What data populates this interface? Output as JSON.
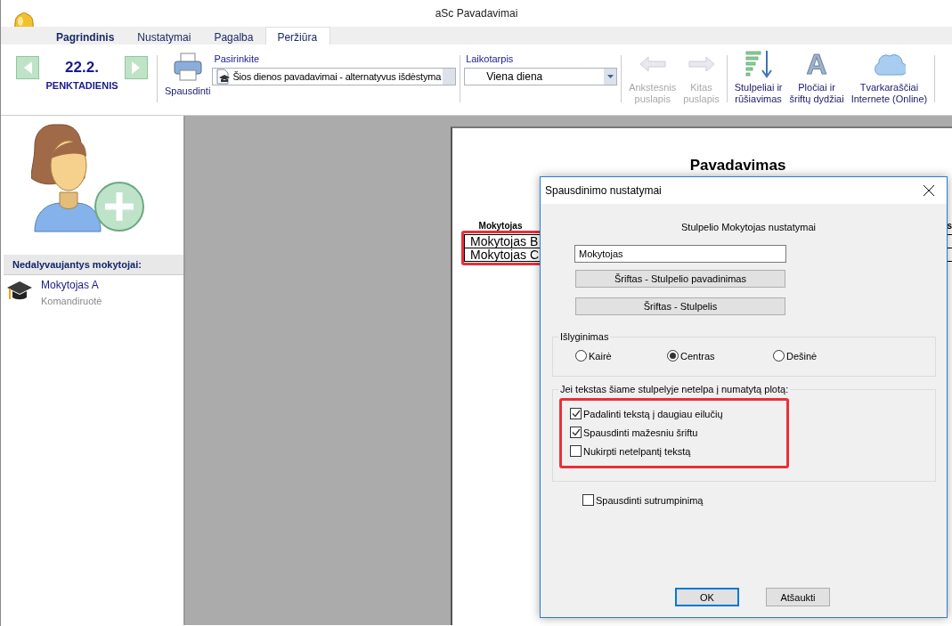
{
  "window": {
    "title": "aSc Pavadavimai"
  },
  "tabs": [
    {
      "label": "Pagrindinis",
      "selected": false
    },
    {
      "label": "Nustatymai",
      "selected": false
    },
    {
      "label": "Pagalba",
      "selected": false
    },
    {
      "label": "Peržiūra",
      "selected": true
    }
  ],
  "date_nav": {
    "date": "22.2.",
    "weekday": "PENKTADIENIS"
  },
  "ribbon": {
    "print_button": "Spausdinti",
    "choose": {
      "label": "Pasirinkite",
      "value": "Šios dienos pavadavimai - alternatyvus išdėstyma"
    },
    "period": {
      "label": "Laikotarpis",
      "value": "Viena diena"
    },
    "buttons": [
      {
        "kind": "prev",
        "lines": [
          "Ankstesnis",
          "puslapis"
        ],
        "disabled": true
      },
      {
        "kind": "next",
        "lines": [
          "Kitas",
          "puslapis"
        ],
        "disabled": true
      },
      {
        "kind": "columns",
        "lines": [
          "Stulpeliai ir",
          "rūšiavimas"
        ],
        "disabled": false
      },
      {
        "kind": "font",
        "glyph": "A",
        "lines": [
          "Pločiai ir",
          "šriftų dydžiai"
        ],
        "disabled": false
      },
      {
        "kind": "cloud",
        "lines": [
          "Tvarkaraščiai",
          "Internete (Online)"
        ],
        "disabled": false
      }
    ]
  },
  "sidebar": {
    "header": "Nedalyvaujantys mokytojai:",
    "items": [
      {
        "name": "Mokytojas A",
        "note": "Komandiruotė"
      }
    ]
  },
  "preview": {
    "title": "Pavadavimas",
    "table": {
      "columns": [
        "Mokytojas",
        "s"
      ],
      "rows": [
        [
          "Mokytojas B"
        ],
        [
          "Mokytojas C"
        ]
      ]
    }
  },
  "dialog": {
    "title": "Spausdinimo nustatymai",
    "heading": "Stulpelio Mokytojas nustatymai",
    "name_field": {
      "value": "Mokytojas"
    },
    "font_buttons": [
      "Šriftas - Stulpelio pavadinimas",
      "Šriftas - Stulpelis"
    ],
    "alignment": {
      "label": "Išlyginimas",
      "options": [
        {
          "label": "Kairė",
          "selected": false
        },
        {
          "label": "Centras",
          "selected": true
        },
        {
          "label": "Dešinė",
          "selected": false
        }
      ]
    },
    "overflow": {
      "label": "Jei tekstas šiame stulpelyje netelpa į numatytą plotą:",
      "options": [
        {
          "label": "Padalinti tekstą į daugiau eilučių",
          "checked": true
        },
        {
          "label": "Spausdinti mažesniu šriftu",
          "checked": true
        },
        {
          "label": "Nukirpti netelpantį tekstą",
          "checked": false
        }
      ]
    },
    "abbreviation": {
      "label": "Spausdinti sutrumpinimą",
      "checked": false
    },
    "buttons": [
      {
        "label": "OK",
        "default": true
      },
      {
        "label": "Atšaukti",
        "default": false
      }
    ]
  }
}
